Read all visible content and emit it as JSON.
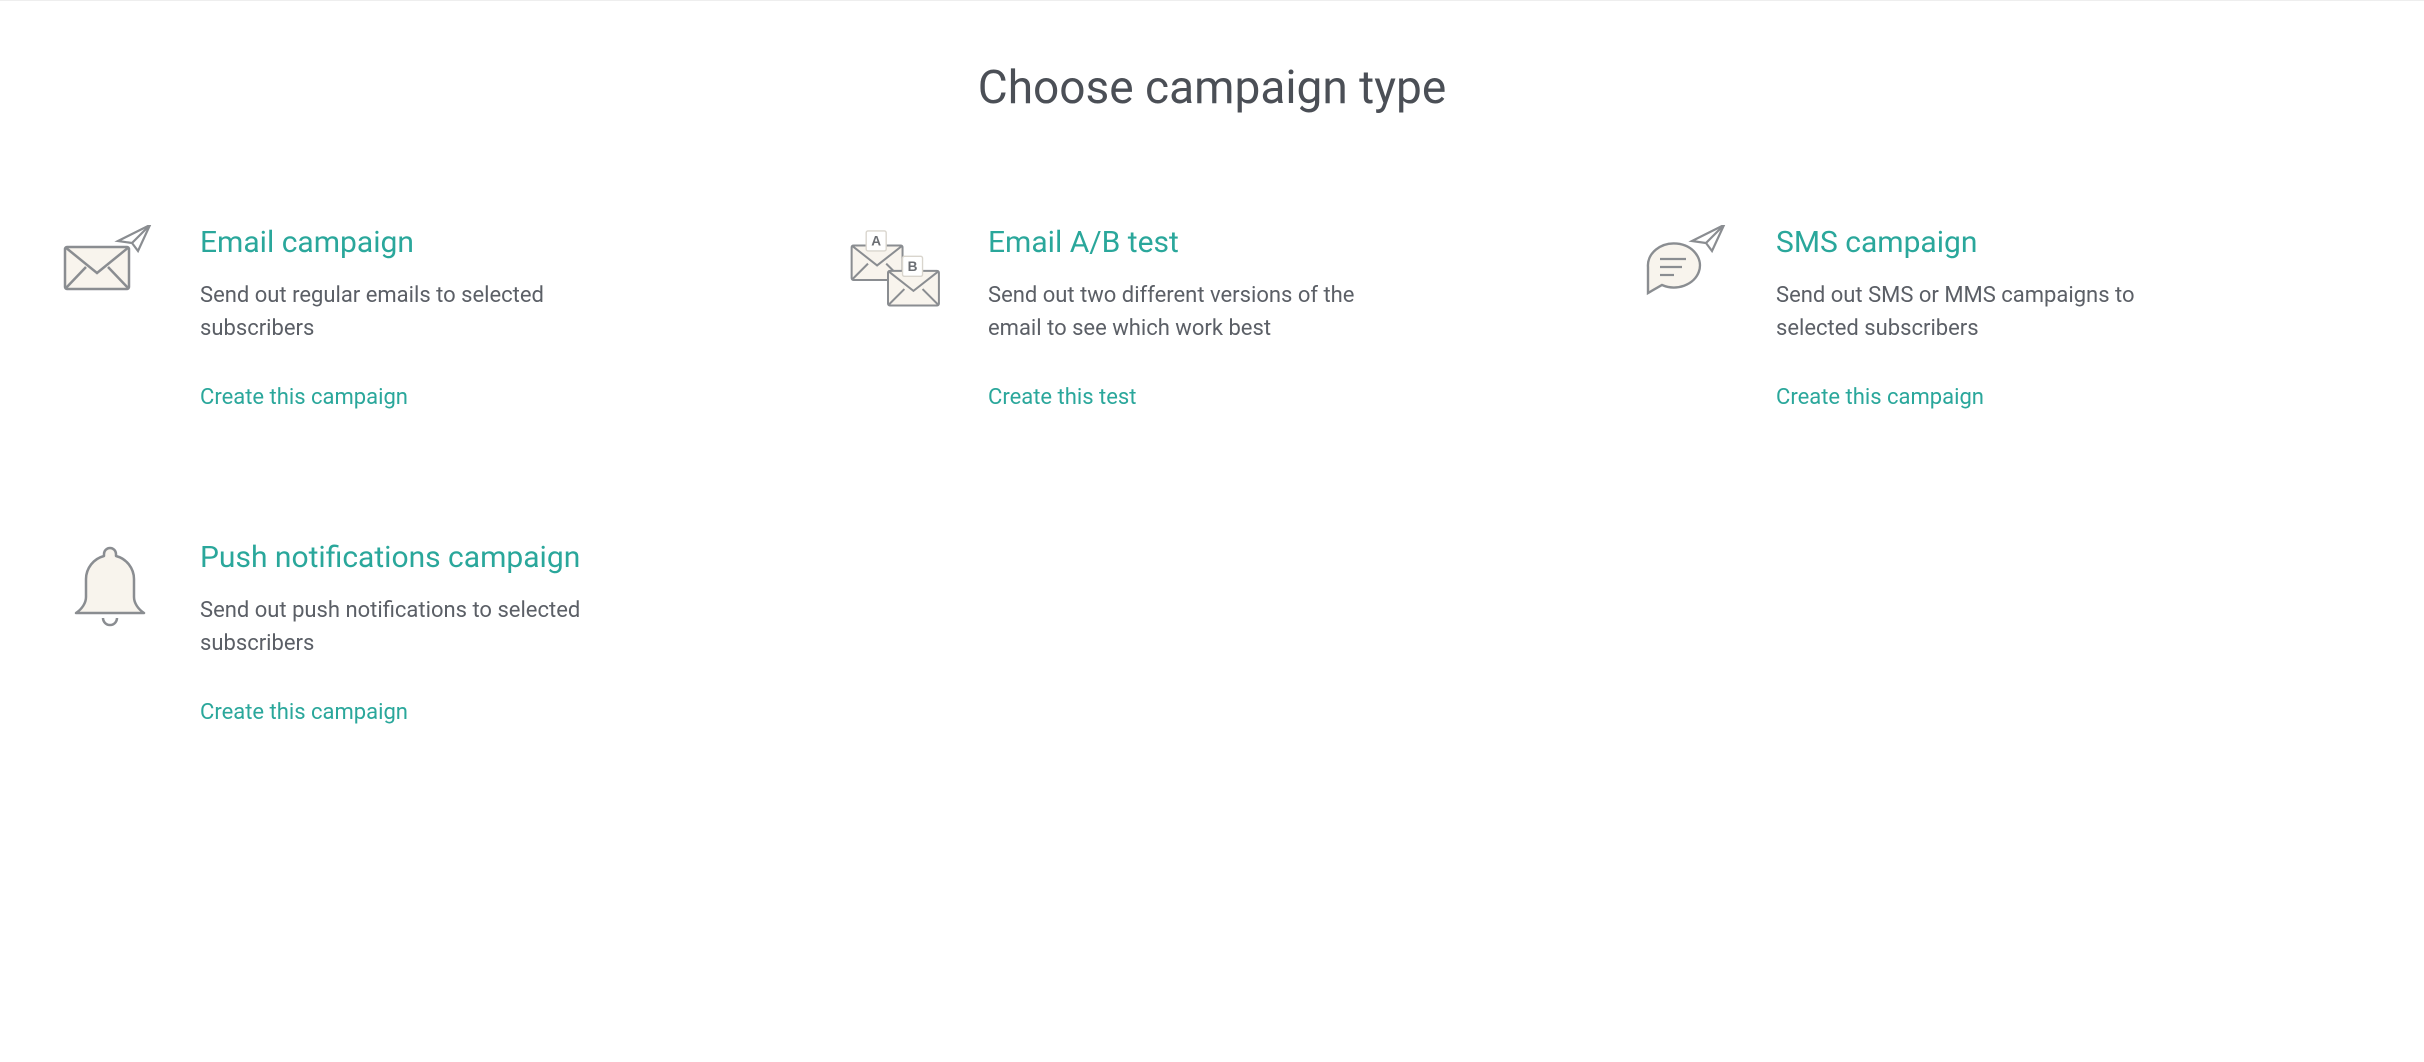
{
  "header": {
    "title": "Choose campaign type"
  },
  "cards": [
    {
      "id": "email",
      "title": "Email campaign",
      "description": "Send out regular emails to selected subscribers",
      "cta": "Create this campaign",
      "icon": "email-send-icon"
    },
    {
      "id": "email-ab",
      "title": "Email A/B test",
      "description": "Send out two different versions of the email to see which work best",
      "cta": "Create this test",
      "icon": "email-ab-icon"
    },
    {
      "id": "sms",
      "title": "SMS campaign",
      "description": "Send out SMS or MMS campaigns to selected subscribers",
      "cta": "Create this campaign",
      "icon": "sms-send-icon"
    },
    {
      "id": "push",
      "title": "Push notifications campaign",
      "description": "Send out push notifications to selected subscribers",
      "cta": "Create this campaign",
      "icon": "bell-icon"
    }
  ],
  "colors": {
    "accent": "#2aa79b",
    "text": "#4b4f56",
    "muted": "#5b5f66",
    "icon_stroke": "#8a8d91",
    "icon_fill": "#f8f4ed"
  }
}
